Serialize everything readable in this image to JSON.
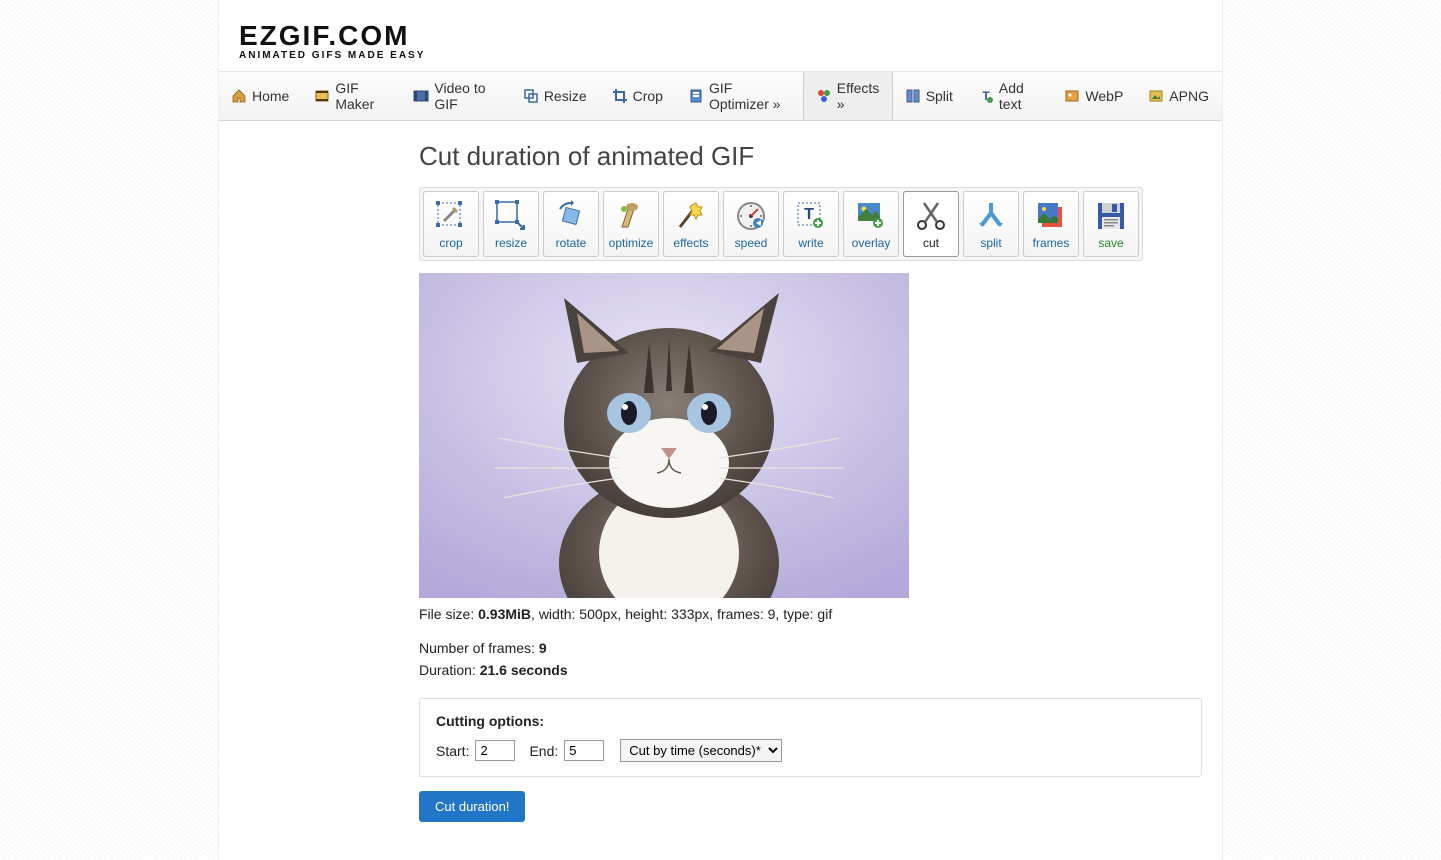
{
  "logo": {
    "main": "EZGIF.COM",
    "sub": "ANIMATED GIFS MADE EASY"
  },
  "nav": [
    {
      "icon": "home",
      "label": "Home"
    },
    {
      "icon": "film",
      "label": "GIF Maker"
    },
    {
      "icon": "video",
      "label": "Video to GIF"
    },
    {
      "icon": "resize",
      "label": "Resize"
    },
    {
      "icon": "crop",
      "label": "Crop"
    },
    {
      "icon": "optimize",
      "label": "GIF Optimizer »"
    },
    {
      "icon": "effects",
      "label": "Effects »",
      "active": true
    },
    {
      "icon": "split",
      "label": "Split"
    },
    {
      "icon": "text",
      "label": "Add text"
    },
    {
      "icon": "webp",
      "label": "WebP"
    },
    {
      "icon": "apng",
      "label": "APNG"
    }
  ],
  "page_title": "Cut duration of animated GIF",
  "tools": [
    {
      "key": "crop",
      "label": "crop"
    },
    {
      "key": "resize",
      "label": "resize"
    },
    {
      "key": "rotate",
      "label": "rotate"
    },
    {
      "key": "optimize",
      "label": "optimize"
    },
    {
      "key": "effects",
      "label": "effects"
    },
    {
      "key": "speed",
      "label": "speed"
    },
    {
      "key": "write",
      "label": "write"
    },
    {
      "key": "overlay",
      "label": "overlay"
    },
    {
      "key": "cut",
      "label": "cut",
      "active": true
    },
    {
      "key": "split",
      "label": "split"
    },
    {
      "key": "frames",
      "label": "frames"
    },
    {
      "key": "save",
      "label": "save",
      "save": true
    }
  ],
  "file_info": {
    "size_label": "File size: ",
    "size_value": "0.93MiB",
    "rest": ", width: 500px, height: 333px, frames: 9, type: gif"
  },
  "frame_info": {
    "frames_label": "Number of frames: ",
    "frames_value": "9",
    "duration_label": "Duration: ",
    "duration_value": "21.6 seconds"
  },
  "options": {
    "title": "Cutting options:",
    "start_label": "Start:",
    "start_value": "2",
    "end_label": "End:",
    "end_value": "5",
    "mode_selected": "Cut by time (seconds)*"
  },
  "submit": "Cut duration!"
}
